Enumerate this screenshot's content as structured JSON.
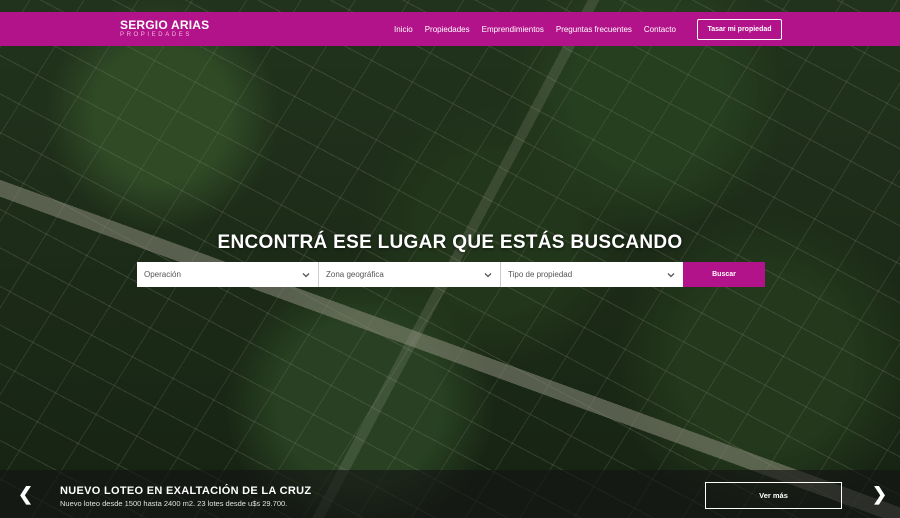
{
  "brand": {
    "name": "SERGIO ARIAS",
    "tagline": "PROPIEDADES",
    "color": "#b3138a"
  },
  "nav": {
    "links": [
      "Inicio",
      "Propiedades",
      "Emprendimientos",
      "Preguntas frecuentes",
      "Contacto"
    ],
    "cta_label": "Tasar mi propiedad"
  },
  "hero": {
    "headline": "ENCONTRÁ ESE LUGAR QUE ESTÁS BUSCANDO"
  },
  "search": {
    "operation": "Operación",
    "zone": "Zona geográfica",
    "property_type": "Tipo de propiedad",
    "button_label": "Buscar",
    "dropdown_icon": "chevron-down-icon"
  },
  "slide": {
    "title": "NUEVO LOTEO EN EXALTACIÓN DE LA CRUZ",
    "description": "Nuevo loteo desde 1500 hasta 2400 m2. 23 lotes desde u$s 29.700.",
    "button_label": "Ver más",
    "prev_icon": "chevron-left-icon",
    "next_icon": "chevron-right-icon"
  }
}
